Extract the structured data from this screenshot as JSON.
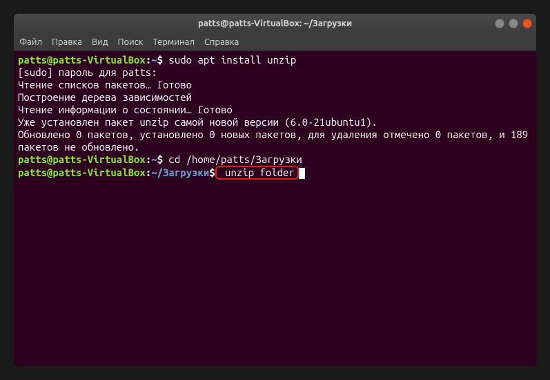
{
  "window": {
    "title": "patts@patts-VirtualBox: ~/Загрузки"
  },
  "menubar": {
    "file": "Файл",
    "edit": "Правка",
    "view": "Вид",
    "search": "Поиск",
    "terminal": "Терминал",
    "help": "Справка"
  },
  "lines": {
    "prompt1": {
      "userhost": "patts@patts-VirtualBox",
      "sep1": ":",
      "path": "~",
      "sep2": "$",
      "cmd": " sudo apt install unzip"
    },
    "out1": "[sudo] пароль для patts:",
    "out2": "Чтение списков пакетов… Готово",
    "out3": "Построение дерева зависимостей",
    "out4": "Чтение информации о состоянии… Готово",
    "out5": "Уже установлен пакет unzip самой новой версии (6.0-21ubuntu1).",
    "out6": "Обновлено 0 пакетов, установлено 0 новых пакетов, для удаления отмечено 0 пакетов, и 189 пакетов не обновлено.",
    "prompt2": {
      "userhost": "patts@patts-VirtualBox",
      "sep1": ":",
      "path": "~",
      "sep2": "$",
      "cmd": " cd /home/patts/Загрузки"
    },
    "prompt3": {
      "userhost": "patts@patts-VirtualBox",
      "sep1": ":",
      "path": "~/Загрузки",
      "sep2": "$",
      "cmd_hl": " unzip folder"
    }
  }
}
